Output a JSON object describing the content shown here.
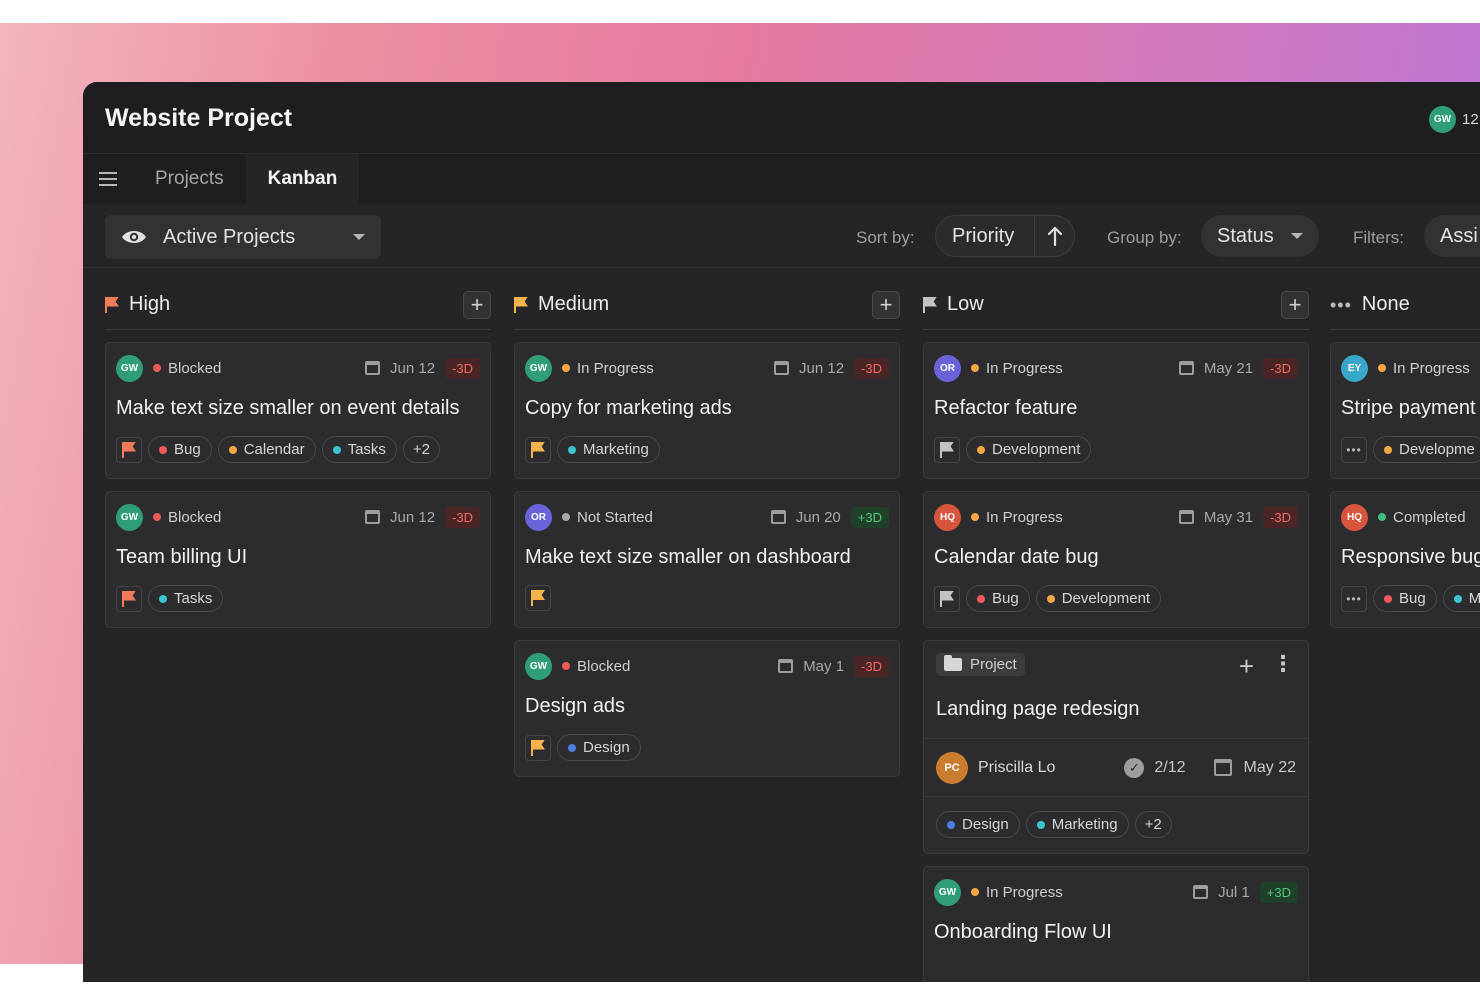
{
  "window": {
    "title": "Website Project",
    "user_initials": "GW",
    "user_count": "12,"
  },
  "nav": {
    "tabs": [
      {
        "label": "Projects"
      },
      {
        "label": "Kanban"
      }
    ]
  },
  "toolbar": {
    "view_label": "Active Projects",
    "sort_label": "Sort by:",
    "sort_value": "Priority",
    "group_label": "Group by:",
    "group_value": "Status",
    "filter_label": "Filters:",
    "filter_value": "Assi"
  },
  "colors": {
    "blocked": "#ec5b58",
    "in_progress": "#f4a742",
    "not_started": "#a8a8ab",
    "completed": "#3fbf7f",
    "bug": "#ec5b58",
    "calendar": "#f4a742",
    "tasks": "#3cc3cf",
    "marketing": "#3cc3cf",
    "development": "#f4a742",
    "design": "#4f7fe0"
  },
  "columns": [
    {
      "name": "High",
      "cards": [
        {
          "initials": "GW",
          "avatar_color": "#2f9e76",
          "status": "Blocked",
          "date": "Jun 12",
          "delta": "-3D",
          "title": "Make text size smaller on event details",
          "tags": [
            "Bug",
            "Calendar",
            "Tasks"
          ],
          "more": "+2"
        },
        {
          "initials": "GW",
          "avatar_color": "#2f9e76",
          "status": "Blocked",
          "date": "Jun 12",
          "delta": "-3D",
          "title": "Team billing UI",
          "tags": [
            "Tasks"
          ]
        }
      ]
    },
    {
      "name": "Medium",
      "cards": [
        {
          "initials": "GW",
          "avatar_color": "#2f9e76",
          "status": "In Progress",
          "date": "Jun 12",
          "delta": "-3D",
          "title": "Copy for marketing ads",
          "tags": [
            "Marketing"
          ]
        },
        {
          "initials": "OR",
          "avatar_color": "#6a62d9",
          "status": "Not Started",
          "date": "Jun 20",
          "delta": "+3D",
          "title": "Make text size smaller on dashboard",
          "tags": []
        },
        {
          "initials": "GW",
          "avatar_color": "#2f9e76",
          "status": "Blocked",
          "date": "May 1",
          "delta": "-3D",
          "title": "Design ads",
          "tags": [
            "Design"
          ]
        }
      ]
    },
    {
      "name": "Low",
      "cards": [
        {
          "initials": "OR",
          "avatar_color": "#6a62d9",
          "status": "In Progress",
          "date": "May 21",
          "delta": "-3D",
          "title": "Refactor feature",
          "tags": [
            "Development"
          ]
        },
        {
          "initials": "HQ",
          "avatar_color": "#d6553c",
          "status": "In Progress",
          "date": "May 31",
          "delta": "-3D",
          "title": "Calendar date bug",
          "tags": [
            "Bug",
            "Development"
          ]
        },
        {
          "initials": "GW",
          "avatar_color": "#2f9e76",
          "status": "In Progress",
          "date": "Jul 1",
          "delta": "+3D",
          "title": "Onboarding Flow UI"
        }
      ],
      "project": {
        "chip": "Project",
        "title": "Landing page redesign",
        "owner_initials": "PC",
        "owner_name": "Priscilla Lo",
        "tasks": "2/12",
        "date": "May 22",
        "tags": [
          "Design",
          "Marketing"
        ],
        "more": "+2"
      }
    },
    {
      "name": "None",
      "cards": [
        {
          "initials": "EY",
          "avatar_color": "#3aa6c9",
          "status": "In Progress",
          "title": "Stripe payment",
          "tags": [
            "Developme"
          ]
        },
        {
          "initials": "HQ",
          "avatar_color": "#d6553c",
          "status": "Completed",
          "title": "Responsive bug",
          "tags": [
            "Bug",
            "M"
          ]
        }
      ]
    }
  ]
}
